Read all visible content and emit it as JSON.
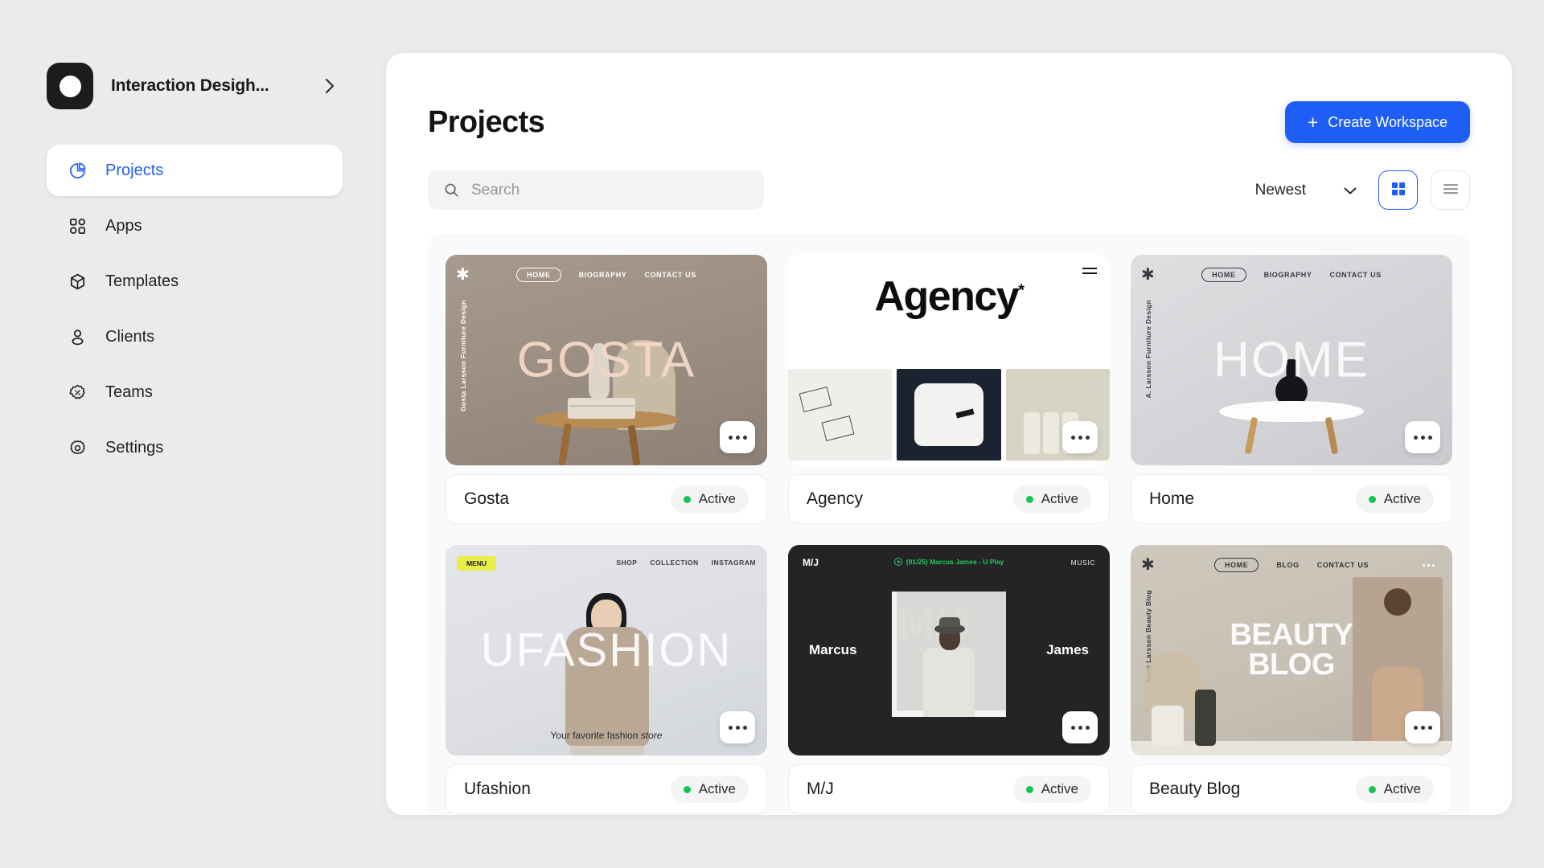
{
  "workspace": {
    "name": "Interaction Desigh...",
    "logo_icon": "circle-logo-icon",
    "expand_icon": "chevron-right-icon"
  },
  "sidebar": {
    "items": [
      {
        "label": "Projects",
        "icon": "pie-chart-icon",
        "active": true
      },
      {
        "label": "Apps",
        "icon": "grid-apps-icon",
        "active": false
      },
      {
        "label": "Templates",
        "icon": "cube-icon",
        "active": false
      },
      {
        "label": "Clients",
        "icon": "user-icon",
        "active": false
      },
      {
        "label": "Teams",
        "icon": "badge-percent-icon",
        "active": false
      },
      {
        "label": "Settings",
        "icon": "gear-icon",
        "active": false
      }
    ]
  },
  "header": {
    "title": "Projects",
    "create_button": {
      "label": "Create Workspace",
      "plus": "+",
      "color": "#1f5ef5"
    }
  },
  "toolbar": {
    "search": {
      "placeholder": "Search",
      "value": "",
      "icon": "search-icon"
    },
    "sort": {
      "value": "Newest",
      "icon": "chevron-down-icon"
    },
    "grid_view": {
      "icon": "grid-view-icon",
      "active": true
    },
    "list_view": {
      "icon": "list-view-icon",
      "active": false
    }
  },
  "status": {
    "active_label": "Active",
    "dot_color": "#19c353"
  },
  "cards": [
    {
      "name": "Gosta",
      "status": "Active",
      "menu_icon": "more-options-icon",
      "art": {
        "nav": [
          "HOME",
          "BIOGRAPHY",
          "CONTACT US"
        ],
        "vertical_label": "Gosta Larsson\nFurniture Design",
        "headline": "GOSTA",
        "logo": "asterisk-icon"
      }
    },
    {
      "name": "Agency",
      "status": "Active",
      "menu_icon": "more-options-icon",
      "art": {
        "headline": "Agency",
        "mark": "*",
        "menu": "hamburger-icon"
      }
    },
    {
      "name": "Home",
      "status": "Active",
      "menu_icon": "more-options-icon",
      "art": {
        "nav": [
          "HOME",
          "BIOGRAPHY",
          "CONTACT US"
        ],
        "vertical_label": "A. Larsson\nFurniture Design",
        "headline": "HOME",
        "logo": "asterisk-icon"
      }
    },
    {
      "name": "Ufashion",
      "status": "Active",
      "menu_icon": "more-options-icon",
      "art": {
        "menu_pill": "MENU",
        "nav": [
          "SHOP",
          "COLLECTION",
          "INSTAGRAM"
        ],
        "headline": "UFASHION",
        "tagline_plain": "Your favorite fashion ",
        "tagline_italic": "store"
      }
    },
    {
      "name": "M/J",
      "status": "Active",
      "menu_icon": "more-options-icon",
      "art": {
        "brand": "M/J",
        "now_playing": "(01/25) Marcus James - U Play",
        "section": "MUSIC",
        "left_name": "Marcus",
        "right_name": "James",
        "cover_text": "M/J",
        "accent": "#27c95f"
      }
    },
    {
      "name": "Beauty Blog",
      "status": "Active",
      "menu_icon": "more-options-icon",
      "art": {
        "nav": [
          "HOME",
          "BLOG",
          "CONTACT US"
        ],
        "vertical_label": "Anna Larsson\nBeauty Blog",
        "headline_line1": "BEAUTY",
        "headline_line2": "BLOG",
        "logo": "asterisk-icon"
      }
    }
  ]
}
